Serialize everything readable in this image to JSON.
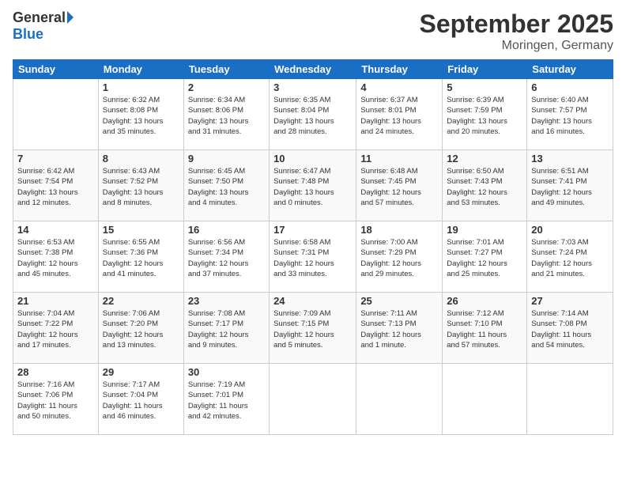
{
  "logo": {
    "general": "General",
    "blue": "Blue"
  },
  "title": "September 2025",
  "location": "Moringen, Germany",
  "days_of_week": [
    "Sunday",
    "Monday",
    "Tuesday",
    "Wednesday",
    "Thursday",
    "Friday",
    "Saturday"
  ],
  "weeks": [
    [
      {
        "day": "",
        "info": ""
      },
      {
        "day": "1",
        "info": "Sunrise: 6:32 AM\nSunset: 8:08 PM\nDaylight: 13 hours\nand 35 minutes."
      },
      {
        "day": "2",
        "info": "Sunrise: 6:34 AM\nSunset: 8:06 PM\nDaylight: 13 hours\nand 31 minutes."
      },
      {
        "day": "3",
        "info": "Sunrise: 6:35 AM\nSunset: 8:04 PM\nDaylight: 13 hours\nand 28 minutes."
      },
      {
        "day": "4",
        "info": "Sunrise: 6:37 AM\nSunset: 8:01 PM\nDaylight: 13 hours\nand 24 minutes."
      },
      {
        "day": "5",
        "info": "Sunrise: 6:39 AM\nSunset: 7:59 PM\nDaylight: 13 hours\nand 20 minutes."
      },
      {
        "day": "6",
        "info": "Sunrise: 6:40 AM\nSunset: 7:57 PM\nDaylight: 13 hours\nand 16 minutes."
      }
    ],
    [
      {
        "day": "7",
        "info": "Sunrise: 6:42 AM\nSunset: 7:54 PM\nDaylight: 13 hours\nand 12 minutes."
      },
      {
        "day": "8",
        "info": "Sunrise: 6:43 AM\nSunset: 7:52 PM\nDaylight: 13 hours\nand 8 minutes."
      },
      {
        "day": "9",
        "info": "Sunrise: 6:45 AM\nSunset: 7:50 PM\nDaylight: 13 hours\nand 4 minutes."
      },
      {
        "day": "10",
        "info": "Sunrise: 6:47 AM\nSunset: 7:48 PM\nDaylight: 13 hours\nand 0 minutes."
      },
      {
        "day": "11",
        "info": "Sunrise: 6:48 AM\nSunset: 7:45 PM\nDaylight: 12 hours\nand 57 minutes."
      },
      {
        "day": "12",
        "info": "Sunrise: 6:50 AM\nSunset: 7:43 PM\nDaylight: 12 hours\nand 53 minutes."
      },
      {
        "day": "13",
        "info": "Sunrise: 6:51 AM\nSunset: 7:41 PM\nDaylight: 12 hours\nand 49 minutes."
      }
    ],
    [
      {
        "day": "14",
        "info": "Sunrise: 6:53 AM\nSunset: 7:38 PM\nDaylight: 12 hours\nand 45 minutes."
      },
      {
        "day": "15",
        "info": "Sunrise: 6:55 AM\nSunset: 7:36 PM\nDaylight: 12 hours\nand 41 minutes."
      },
      {
        "day": "16",
        "info": "Sunrise: 6:56 AM\nSunset: 7:34 PM\nDaylight: 12 hours\nand 37 minutes."
      },
      {
        "day": "17",
        "info": "Sunrise: 6:58 AM\nSunset: 7:31 PM\nDaylight: 12 hours\nand 33 minutes."
      },
      {
        "day": "18",
        "info": "Sunrise: 7:00 AM\nSunset: 7:29 PM\nDaylight: 12 hours\nand 29 minutes."
      },
      {
        "day": "19",
        "info": "Sunrise: 7:01 AM\nSunset: 7:27 PM\nDaylight: 12 hours\nand 25 minutes."
      },
      {
        "day": "20",
        "info": "Sunrise: 7:03 AM\nSunset: 7:24 PM\nDaylight: 12 hours\nand 21 minutes."
      }
    ],
    [
      {
        "day": "21",
        "info": "Sunrise: 7:04 AM\nSunset: 7:22 PM\nDaylight: 12 hours\nand 17 minutes."
      },
      {
        "day": "22",
        "info": "Sunrise: 7:06 AM\nSunset: 7:20 PM\nDaylight: 12 hours\nand 13 minutes."
      },
      {
        "day": "23",
        "info": "Sunrise: 7:08 AM\nSunset: 7:17 PM\nDaylight: 12 hours\nand 9 minutes."
      },
      {
        "day": "24",
        "info": "Sunrise: 7:09 AM\nSunset: 7:15 PM\nDaylight: 12 hours\nand 5 minutes."
      },
      {
        "day": "25",
        "info": "Sunrise: 7:11 AM\nSunset: 7:13 PM\nDaylight: 12 hours\nand 1 minute."
      },
      {
        "day": "26",
        "info": "Sunrise: 7:12 AM\nSunset: 7:10 PM\nDaylight: 11 hours\nand 57 minutes."
      },
      {
        "day": "27",
        "info": "Sunrise: 7:14 AM\nSunset: 7:08 PM\nDaylight: 11 hours\nand 54 minutes."
      }
    ],
    [
      {
        "day": "28",
        "info": "Sunrise: 7:16 AM\nSunset: 7:06 PM\nDaylight: 11 hours\nand 50 minutes."
      },
      {
        "day": "29",
        "info": "Sunrise: 7:17 AM\nSunset: 7:04 PM\nDaylight: 11 hours\nand 46 minutes."
      },
      {
        "day": "30",
        "info": "Sunrise: 7:19 AM\nSunset: 7:01 PM\nDaylight: 11 hours\nand 42 minutes."
      },
      {
        "day": "",
        "info": ""
      },
      {
        "day": "",
        "info": ""
      },
      {
        "day": "",
        "info": ""
      },
      {
        "day": "",
        "info": ""
      }
    ]
  ]
}
